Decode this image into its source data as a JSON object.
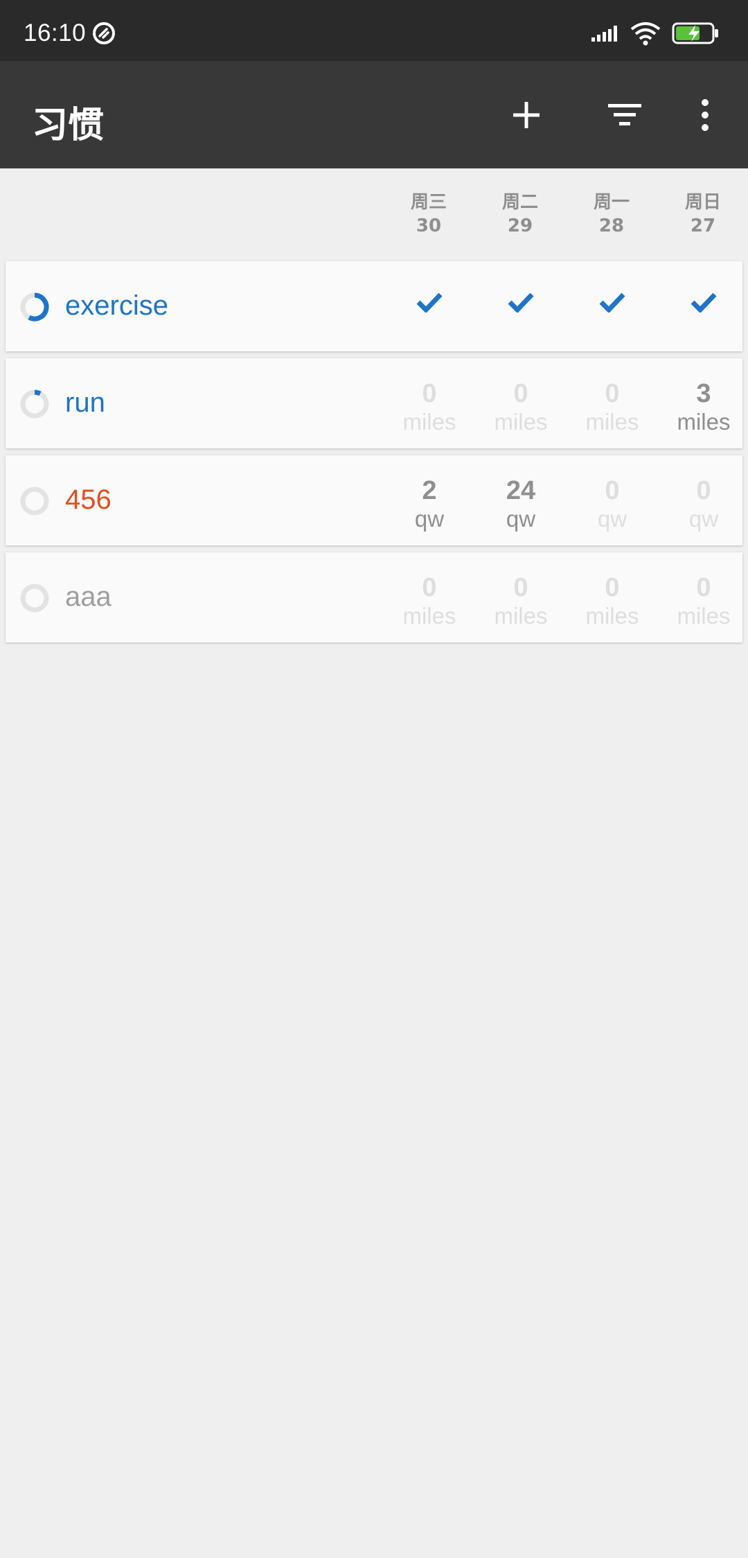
{
  "status": {
    "time": "16:10"
  },
  "appbar": {
    "title": "习惯",
    "icons": [
      "add-icon",
      "filter-icon",
      "more-vert-icon"
    ]
  },
  "days": [
    {
      "name": "周三",
      "num": "30"
    },
    {
      "name": "周二",
      "num": "29"
    },
    {
      "name": "周一",
      "num": "28"
    },
    {
      "name": "周日",
      "num": "27"
    }
  ],
  "colors": {
    "blue": "#1e74c8",
    "orange": "#e0501e",
    "grey": "#9e9e9e"
  },
  "habits": [
    {
      "name": "exercise",
      "type": "checks",
      "checked": [
        true,
        true,
        true,
        true
      ]
    },
    {
      "name": "run",
      "type": "values",
      "values": [
        "0",
        "0",
        "0",
        "3"
      ],
      "units": [
        "miles",
        "miles",
        "miles",
        "miles"
      ]
    },
    {
      "name": "456",
      "type": "values",
      "values": [
        "2",
        "24",
        "0",
        "0"
      ],
      "units": [
        "qw",
        "qw",
        "qw",
        "qw"
      ]
    },
    {
      "name": "aaa",
      "type": "values",
      "values": [
        "0",
        "0",
        "0",
        "0"
      ],
      "units": [
        "miles",
        "miles",
        "miles",
        "miles"
      ]
    }
  ]
}
